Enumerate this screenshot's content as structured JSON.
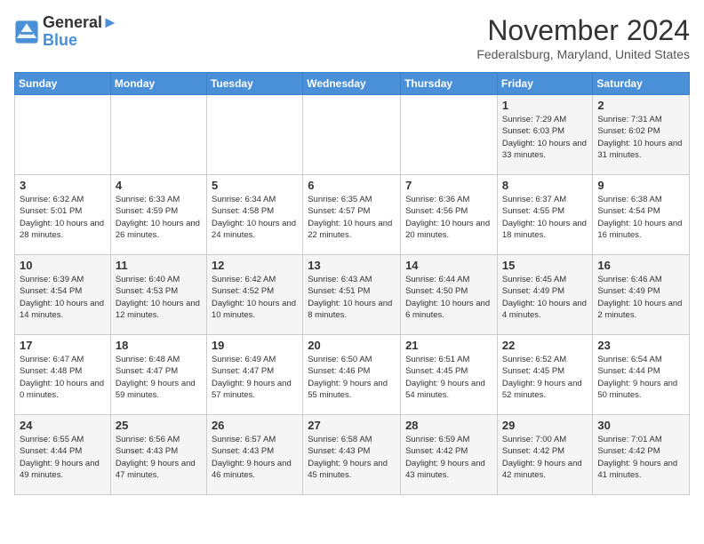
{
  "header": {
    "logo_line1": "General",
    "logo_line2": "Blue",
    "month": "November 2024",
    "location": "Federalsburg, Maryland, United States"
  },
  "weekdays": [
    "Sunday",
    "Monday",
    "Tuesday",
    "Wednesday",
    "Thursday",
    "Friday",
    "Saturday"
  ],
  "weeks": [
    [
      {
        "day": "",
        "info": ""
      },
      {
        "day": "",
        "info": ""
      },
      {
        "day": "",
        "info": ""
      },
      {
        "day": "",
        "info": ""
      },
      {
        "day": "",
        "info": ""
      },
      {
        "day": "1",
        "info": "Sunrise: 7:29 AM\nSunset: 6:03 PM\nDaylight: 10 hours and 33 minutes."
      },
      {
        "day": "2",
        "info": "Sunrise: 7:31 AM\nSunset: 6:02 PM\nDaylight: 10 hours and 31 minutes."
      }
    ],
    [
      {
        "day": "3",
        "info": "Sunrise: 6:32 AM\nSunset: 5:01 PM\nDaylight: 10 hours and 28 minutes."
      },
      {
        "day": "4",
        "info": "Sunrise: 6:33 AM\nSunset: 4:59 PM\nDaylight: 10 hours and 26 minutes."
      },
      {
        "day": "5",
        "info": "Sunrise: 6:34 AM\nSunset: 4:58 PM\nDaylight: 10 hours and 24 minutes."
      },
      {
        "day": "6",
        "info": "Sunrise: 6:35 AM\nSunset: 4:57 PM\nDaylight: 10 hours and 22 minutes."
      },
      {
        "day": "7",
        "info": "Sunrise: 6:36 AM\nSunset: 4:56 PM\nDaylight: 10 hours and 20 minutes."
      },
      {
        "day": "8",
        "info": "Sunrise: 6:37 AM\nSunset: 4:55 PM\nDaylight: 10 hours and 18 minutes."
      },
      {
        "day": "9",
        "info": "Sunrise: 6:38 AM\nSunset: 4:54 PM\nDaylight: 10 hours and 16 minutes."
      }
    ],
    [
      {
        "day": "10",
        "info": "Sunrise: 6:39 AM\nSunset: 4:54 PM\nDaylight: 10 hours and 14 minutes."
      },
      {
        "day": "11",
        "info": "Sunrise: 6:40 AM\nSunset: 4:53 PM\nDaylight: 10 hours and 12 minutes."
      },
      {
        "day": "12",
        "info": "Sunrise: 6:42 AM\nSunset: 4:52 PM\nDaylight: 10 hours and 10 minutes."
      },
      {
        "day": "13",
        "info": "Sunrise: 6:43 AM\nSunset: 4:51 PM\nDaylight: 10 hours and 8 minutes."
      },
      {
        "day": "14",
        "info": "Sunrise: 6:44 AM\nSunset: 4:50 PM\nDaylight: 10 hours and 6 minutes."
      },
      {
        "day": "15",
        "info": "Sunrise: 6:45 AM\nSunset: 4:49 PM\nDaylight: 10 hours and 4 minutes."
      },
      {
        "day": "16",
        "info": "Sunrise: 6:46 AM\nSunset: 4:49 PM\nDaylight: 10 hours and 2 minutes."
      }
    ],
    [
      {
        "day": "17",
        "info": "Sunrise: 6:47 AM\nSunset: 4:48 PM\nDaylight: 10 hours and 0 minutes."
      },
      {
        "day": "18",
        "info": "Sunrise: 6:48 AM\nSunset: 4:47 PM\nDaylight: 9 hours and 59 minutes."
      },
      {
        "day": "19",
        "info": "Sunrise: 6:49 AM\nSunset: 4:47 PM\nDaylight: 9 hours and 57 minutes."
      },
      {
        "day": "20",
        "info": "Sunrise: 6:50 AM\nSunset: 4:46 PM\nDaylight: 9 hours and 55 minutes."
      },
      {
        "day": "21",
        "info": "Sunrise: 6:51 AM\nSunset: 4:45 PM\nDaylight: 9 hours and 54 minutes."
      },
      {
        "day": "22",
        "info": "Sunrise: 6:52 AM\nSunset: 4:45 PM\nDaylight: 9 hours and 52 minutes."
      },
      {
        "day": "23",
        "info": "Sunrise: 6:54 AM\nSunset: 4:44 PM\nDaylight: 9 hours and 50 minutes."
      }
    ],
    [
      {
        "day": "24",
        "info": "Sunrise: 6:55 AM\nSunset: 4:44 PM\nDaylight: 9 hours and 49 minutes."
      },
      {
        "day": "25",
        "info": "Sunrise: 6:56 AM\nSunset: 4:43 PM\nDaylight: 9 hours and 47 minutes."
      },
      {
        "day": "26",
        "info": "Sunrise: 6:57 AM\nSunset: 4:43 PM\nDaylight: 9 hours and 46 minutes."
      },
      {
        "day": "27",
        "info": "Sunrise: 6:58 AM\nSunset: 4:43 PM\nDaylight: 9 hours and 45 minutes."
      },
      {
        "day": "28",
        "info": "Sunrise: 6:59 AM\nSunset: 4:42 PM\nDaylight: 9 hours and 43 minutes."
      },
      {
        "day": "29",
        "info": "Sunrise: 7:00 AM\nSunset: 4:42 PM\nDaylight: 9 hours and 42 minutes."
      },
      {
        "day": "30",
        "info": "Sunrise: 7:01 AM\nSunset: 4:42 PM\nDaylight: 9 hours and 41 minutes."
      }
    ]
  ]
}
